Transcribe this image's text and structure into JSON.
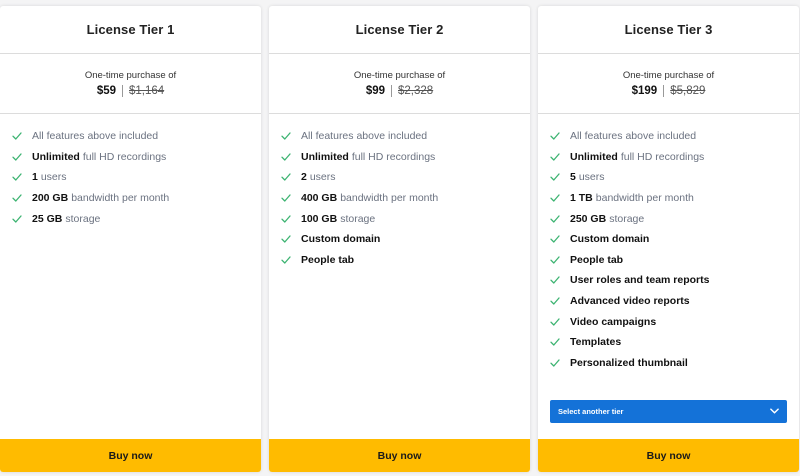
{
  "colors": {
    "check": "#3cb371",
    "buy_button": "#ffbb00",
    "select_button": "#1472d8"
  },
  "tiers": [
    {
      "title": "License Tier 1",
      "caption": "One-time purchase of",
      "price": "$59",
      "old_price": "$1,164",
      "features": [
        {
          "strong": "",
          "text": "All features above included"
        },
        {
          "strong": "Unlimited",
          "text": "full HD recordings"
        },
        {
          "strong": "1",
          "text": "users"
        },
        {
          "strong": "200 GB",
          "text": "bandwidth per month"
        },
        {
          "strong": "25 GB",
          "text": "storage"
        }
      ],
      "buy_label": "Buy now"
    },
    {
      "title": "License Tier 2",
      "caption": "One-time purchase of",
      "price": "$99",
      "old_price": "$2,328",
      "features": [
        {
          "strong": "",
          "text": "All features above included"
        },
        {
          "strong": "Unlimited",
          "text": "full HD recordings"
        },
        {
          "strong": "2",
          "text": "users"
        },
        {
          "strong": "400 GB",
          "text": "bandwidth per month"
        },
        {
          "strong": "100 GB",
          "text": "storage"
        },
        {
          "strong": "Custom domain",
          "text": ""
        },
        {
          "strong": "People tab",
          "text": ""
        }
      ],
      "buy_label": "Buy now"
    },
    {
      "title": "License Tier 3",
      "caption": "One-time purchase of",
      "price": "$199",
      "old_price": "$5,829",
      "features": [
        {
          "strong": "",
          "text": "All features above included"
        },
        {
          "strong": "Unlimited",
          "text": "full HD recordings"
        },
        {
          "strong": "5",
          "text": "users"
        },
        {
          "strong": "1 TB",
          "text": "bandwidth per month"
        },
        {
          "strong": "250 GB",
          "text": "storage"
        },
        {
          "strong": "Custom domain",
          "text": ""
        },
        {
          "strong": "People tab",
          "text": ""
        },
        {
          "strong": "User roles and team reports",
          "text": ""
        },
        {
          "strong": "Advanced video reports",
          "text": ""
        },
        {
          "strong": "Video campaigns",
          "text": ""
        },
        {
          "strong": "Templates",
          "text": ""
        },
        {
          "strong": "Personalized thumbnail",
          "text": ""
        }
      ],
      "select_label": "Select another tier",
      "buy_label": "Buy now"
    }
  ]
}
